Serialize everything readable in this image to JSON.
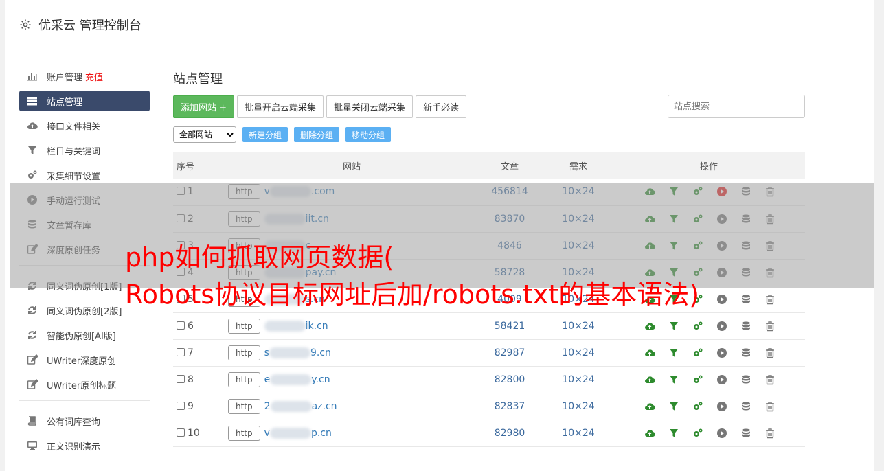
{
  "header": {
    "title": "优采云 管理控制台"
  },
  "sidebar": {
    "items": [
      {
        "label": "账户管理",
        "badge": "充值",
        "icon": "bar-chart-icon"
      },
      {
        "label": "站点管理",
        "icon": "server-icon",
        "active": true
      },
      {
        "label": "接口文件相关",
        "icon": "cloud-upload-icon"
      },
      {
        "label": "栏目与关键词",
        "icon": "filter-icon"
      },
      {
        "label": "采集细节设置",
        "icon": "gears-icon"
      },
      {
        "label": "手动运行测试",
        "icon": "play-icon"
      },
      {
        "label": "文章暂存库",
        "icon": "database-icon"
      },
      {
        "label": "深度原创任务",
        "icon": "edit-icon"
      },
      {
        "label": "同义词伪原创[1版]",
        "icon": "refresh-icon"
      },
      {
        "label": "同义词伪原创[2版]",
        "icon": "refresh-icon"
      },
      {
        "label": "智能伪原创[AI版]",
        "icon": "refresh-icon"
      },
      {
        "label": "UWriter深度原创",
        "icon": "edit-icon"
      },
      {
        "label": "UWriter原创标题",
        "icon": "edit-icon"
      },
      {
        "label": "公有词库查询",
        "icon": "book-icon"
      },
      {
        "label": "正文识别演示",
        "icon": "monitor-icon"
      }
    ]
  },
  "main": {
    "title": "站点管理",
    "toolbar": {
      "add_site": "添加网站 +",
      "batch_open": "批量开启云端采集",
      "batch_close": "批量关闭云端采集",
      "guide": "新手必读",
      "search_placeholder": "站点搜索"
    },
    "filter": {
      "group_select": "全部网站",
      "new_group": "新建分组",
      "delete_group": "删除分组",
      "move_group": "移动分组"
    },
    "table": {
      "headers": {
        "no": "序号",
        "site": "网站",
        "articles": "文章",
        "demand": "需求",
        "ops": "操作"
      },
      "rows": [
        {
          "no": "1",
          "protocol": "http",
          "prefix": "v",
          "suffix": ".com",
          "articles": "456814",
          "demand": "10×24"
        },
        {
          "no": "2",
          "protocol": "http",
          "prefix": "",
          "suffix": "iit.cn",
          "articles": "83870",
          "demand": "10×24"
        },
        {
          "no": "3",
          "protocol": "http",
          "prefix": "",
          "suffix": "c",
          "articles": "4846",
          "demand": "10×24"
        },
        {
          "no": "4",
          "protocol": "http",
          "prefix": "",
          "suffix": "pay.cn",
          "articles": "58728",
          "demand": "10×24"
        },
        {
          "no": "5",
          "protocol": "http",
          "prefix": "",
          "suffix": "s.cn",
          "articles": "4009",
          "demand": "10×24"
        },
        {
          "no": "6",
          "protocol": "http",
          "prefix": "",
          "suffix": "ik.cn",
          "articles": "58421",
          "demand": "10×24"
        },
        {
          "no": "7",
          "protocol": "http",
          "prefix": "s",
          "suffix": "9.cn",
          "articles": "82987",
          "demand": "10×24"
        },
        {
          "no": "8",
          "protocol": "http",
          "prefix": "e",
          "suffix": "y.cn",
          "articles": "82800",
          "demand": "10×24"
        },
        {
          "no": "9",
          "protocol": "http",
          "prefix": "2",
          "suffix": "az.cn",
          "articles": "82837",
          "demand": "10×24"
        },
        {
          "no": "10",
          "protocol": "http",
          "prefix": "v",
          "suffix": "p.cn",
          "articles": "82980",
          "demand": "10×24"
        }
      ]
    }
  },
  "caption": {
    "line1": "php如何抓取网页数据(",
    "line2": "Robots协议目标网址后加/robots.txt的基本语法)"
  },
  "colors": {
    "green_btn": "#5cb85c",
    "blue_btn": "#5bb0f3",
    "active_nav": "#3a4a6b",
    "caption_red": "#ff0000",
    "op_green": "#2e8b2e",
    "op_red": "#e02020"
  }
}
